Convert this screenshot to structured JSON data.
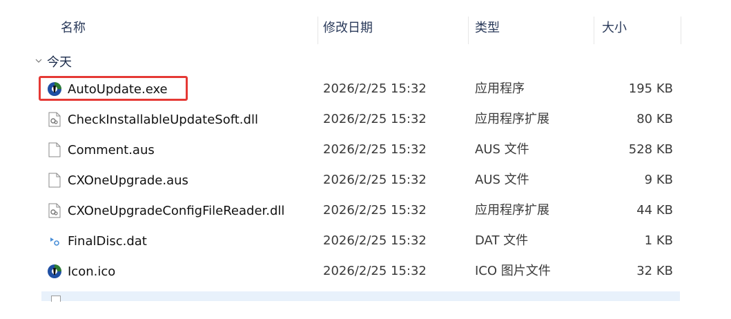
{
  "header": {
    "name": "名称",
    "date": "修改日期",
    "type": "类型",
    "size": "大小"
  },
  "group": {
    "label": "今天"
  },
  "files": [
    {
      "name": "AutoUpdate.exe",
      "date": "2026/2/25 15:32",
      "type": "应用程序",
      "size": "195 KB",
      "icon": "app-exe-icon"
    },
    {
      "name": "CheckInstallableUpdateSoft.dll",
      "date": "2026/2/25 15:32",
      "type": "应用程序扩展",
      "size": "80 KB",
      "icon": "dll-file-icon"
    },
    {
      "name": "Comment.aus",
      "date": "2026/2/25 15:32",
      "type": "AUS 文件",
      "size": "528 KB",
      "icon": "blank-file-icon"
    },
    {
      "name": "CXOneUpgrade.aus",
      "date": "2026/2/25 15:32",
      "type": "AUS 文件",
      "size": "9 KB",
      "icon": "blank-file-icon"
    },
    {
      "name": "CXOneUpgradeConfigFileReader.dll",
      "date": "2026/2/25 15:32",
      "type": "应用程序扩展",
      "size": "44 KB",
      "icon": "dll-file-icon"
    },
    {
      "name": "FinalDisc.dat",
      "date": "2026/2/25 15:32",
      "type": "DAT 文件",
      "size": "1 KB",
      "icon": "dat-file-icon"
    },
    {
      "name": "Icon.ico",
      "date": "2026/2/25 15:32",
      "type": "ICO 图片文件",
      "size": "32 KB",
      "icon": "app-exe-icon"
    }
  ],
  "colors": {
    "highlight": "#e53935",
    "selection": "#e8f1fb"
  }
}
